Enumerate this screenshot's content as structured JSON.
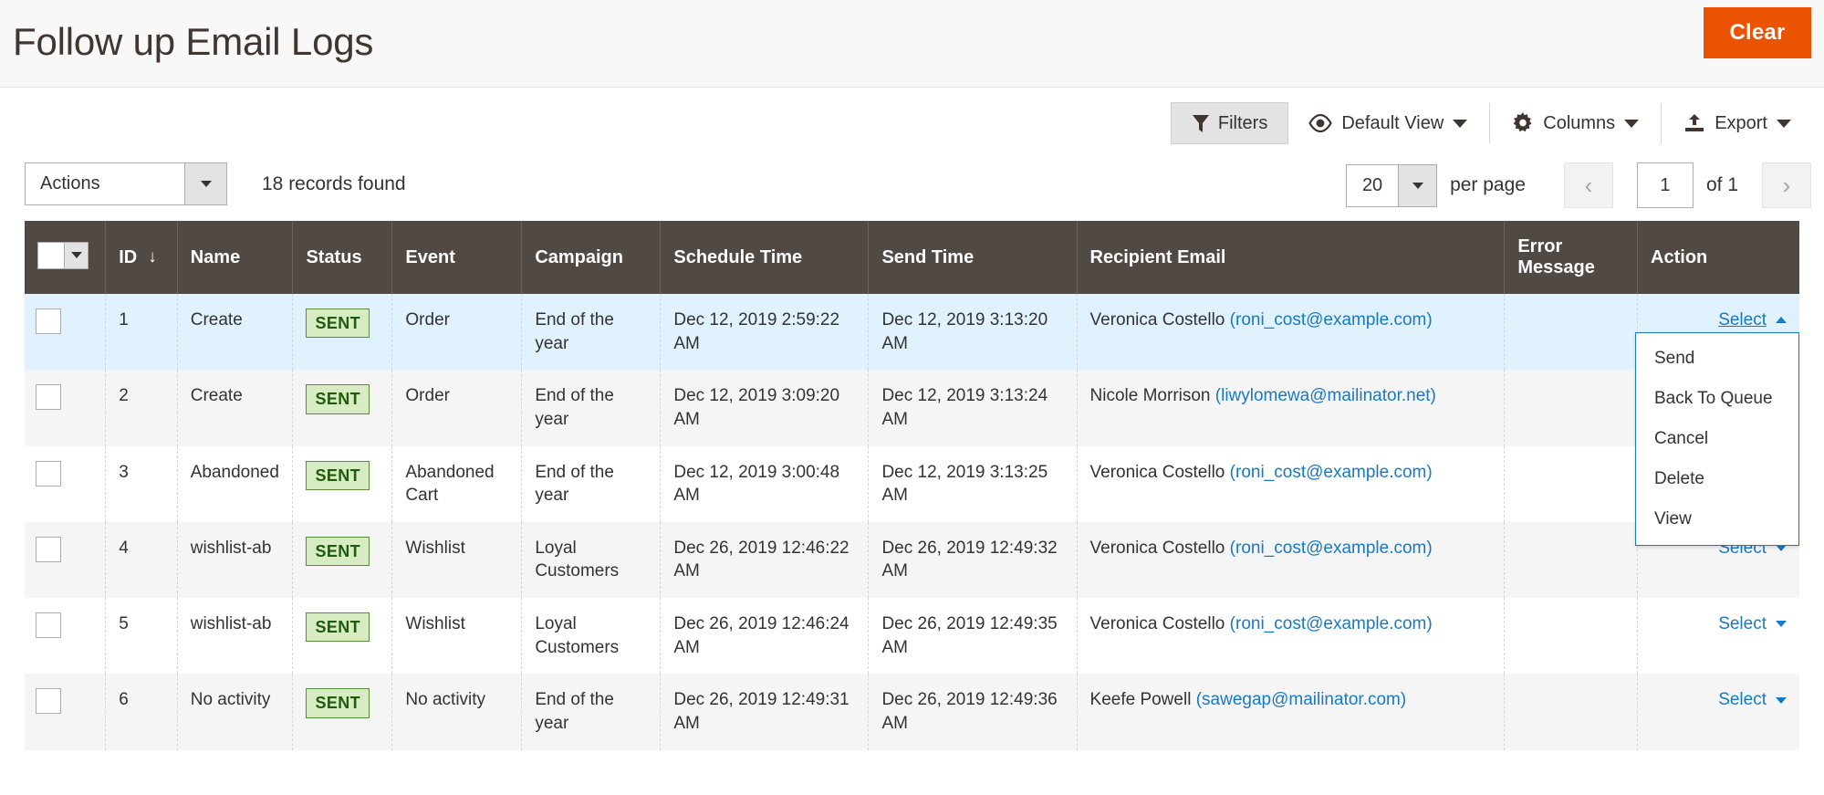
{
  "header": {
    "title": "Follow up Email Logs",
    "clear_label": "Clear"
  },
  "toolbar": {
    "filters_label": "Filters",
    "default_view_label": "Default View",
    "columns_label": "Columns",
    "export_label": "Export",
    "icons": {
      "filters": "funnel-icon",
      "default_view": "eye-icon",
      "columns": "gear-icon",
      "export": "export-upload-icon"
    }
  },
  "grid_actions": {
    "actions_label": "Actions",
    "records_found": "18 records found"
  },
  "pager": {
    "per_page_value": "20",
    "per_page_label": "per page",
    "prev_icon": "chevron-left-icon",
    "next_icon": "chevron-right-icon",
    "current_page": "1",
    "of_label": "of 1"
  },
  "table": {
    "columns": [
      {
        "key": "checkbox",
        "label": ""
      },
      {
        "key": "id",
        "label": "ID",
        "sort": "↓"
      },
      {
        "key": "name",
        "label": "Name"
      },
      {
        "key": "status",
        "label": "Status"
      },
      {
        "key": "event",
        "label": "Event"
      },
      {
        "key": "campaign",
        "label": "Campaign"
      },
      {
        "key": "schedule_time",
        "label": "Schedule Time"
      },
      {
        "key": "send_time",
        "label": "Send Time"
      },
      {
        "key": "recipient_email",
        "label": "Recipient Email"
      },
      {
        "key": "error_message",
        "label": "Error Message"
      },
      {
        "key": "action",
        "label": "Action"
      }
    ],
    "action_link_label": "Select",
    "rows": [
      {
        "id": "1",
        "name": "Create",
        "status": "SENT",
        "event": "Order",
        "campaign": "End of the year",
        "schedule_time": "Dec 12, 2019 2:59:22 AM",
        "send_time": "Dec 12, 2019 3:13:20 AM",
        "recipient_name": "Veronica Costello",
        "recipient_email": "(roni_cost@example.com)",
        "error_message": ""
      },
      {
        "id": "2",
        "name": "Create",
        "status": "SENT",
        "event": "Order",
        "campaign": "End of the year",
        "schedule_time": "Dec 12, 2019 3:09:20 AM",
        "send_time": "Dec 12, 2019 3:13:24 AM",
        "recipient_name": "Nicole Morrison",
        "recipient_email": "(liwylomewa@mailinator.net)",
        "error_message": ""
      },
      {
        "id": "3",
        "name": "Abandoned",
        "status": "SENT",
        "event": "Abandoned Cart",
        "campaign": "End of the year",
        "schedule_time": "Dec 12, 2019 3:00:48 AM",
        "send_time": "Dec 12, 2019 3:13:25 AM",
        "recipient_name": "Veronica Costello",
        "recipient_email": "(roni_cost@example.com)",
        "error_message": ""
      },
      {
        "id": "4",
        "name": "wishlist-ab",
        "status": "SENT",
        "event": "Wishlist",
        "campaign": "Loyal Customers",
        "schedule_time": "Dec 26, 2019 12:46:22 AM",
        "send_time": "Dec 26, 2019 12:49:32 AM",
        "recipient_name": "Veronica Costello",
        "recipient_email": "(roni_cost@example.com)",
        "error_message": ""
      },
      {
        "id": "5",
        "name": "wishlist-ab",
        "status": "SENT",
        "event": "Wishlist",
        "campaign": "Loyal Customers",
        "schedule_time": "Dec 26, 2019 12:46:24 AM",
        "send_time": "Dec 26, 2019 12:49:35 AM",
        "recipient_name": "Veronica Costello",
        "recipient_email": "(roni_cost@example.com)",
        "error_message": ""
      },
      {
        "id": "6",
        "name": "No activity",
        "status": "SENT",
        "event": "No activity",
        "campaign": "End of the year",
        "schedule_time": "Dec 26, 2019 12:49:31 AM",
        "send_time": "Dec 26, 2019 12:49:36 AM",
        "recipient_name": "Keefe Powell",
        "recipient_email": "(sawegap@mailinator.com)",
        "error_message": ""
      }
    ]
  },
  "action_menu": {
    "open_for_row_id": "1",
    "items": [
      {
        "label": "Send"
      },
      {
        "label": "Back To Queue"
      },
      {
        "label": "Cancel"
      },
      {
        "label": "Delete"
      },
      {
        "label": "View"
      }
    ]
  },
  "colors": {
    "accent_orange": "#eb5202",
    "header_dark": "#514943",
    "link_blue": "#1979c3",
    "badge_green_bg": "#d8ecc4",
    "badge_green_text": "#1c5c0a",
    "row_hover": "#e0f2fd"
  }
}
